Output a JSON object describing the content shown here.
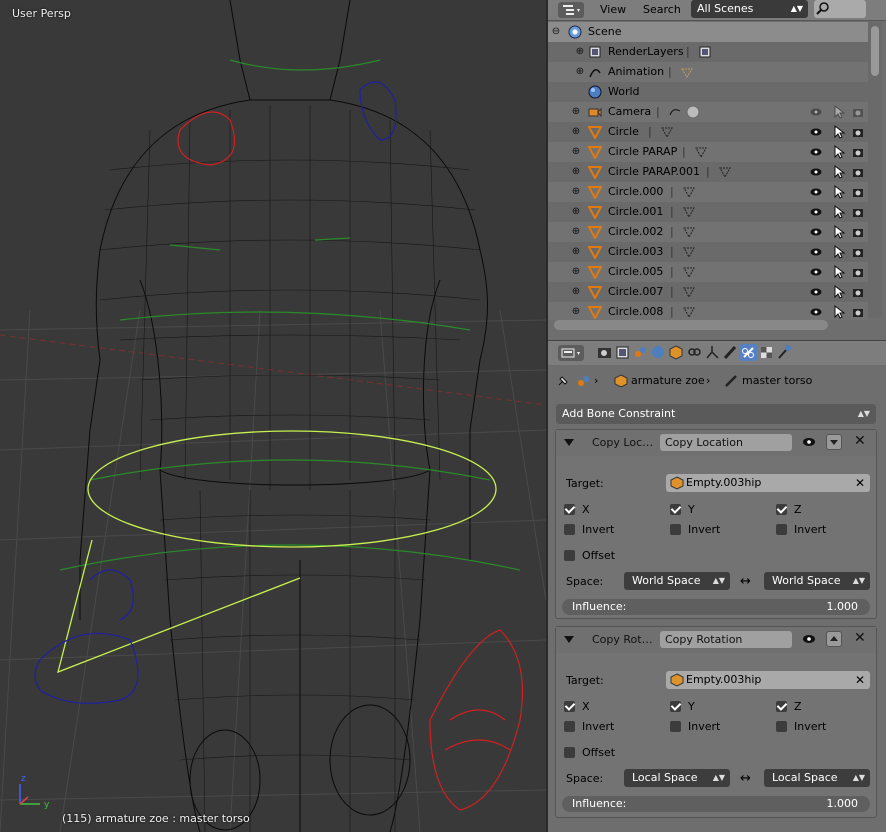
{
  "viewport": {
    "view_label": "User Persp",
    "status": "(115) armature zoe : master torso"
  },
  "outliner": {
    "header": {
      "menu_view": "View",
      "menu_search": "Search",
      "scenes_dropdown": "All Scenes"
    },
    "rows": [
      {
        "name": "Scene",
        "icon": "scene-icon"
      },
      {
        "name": "RenderLayers",
        "icon": "renderlayers-icon"
      },
      {
        "name": "Animation",
        "icon": "animation-icon"
      },
      {
        "name": "World",
        "icon": "world-icon"
      },
      {
        "name": "Camera",
        "icon": "camera-icon"
      },
      {
        "name": "Circle",
        "icon": "mesh-icon"
      },
      {
        "name": "Circle PARAP",
        "icon": "mesh-icon"
      },
      {
        "name": "Circle PARAP.001",
        "icon": "mesh-icon"
      },
      {
        "name": "Circle.000",
        "icon": "mesh-icon"
      },
      {
        "name": "Circle.001",
        "icon": "mesh-icon"
      },
      {
        "name": "Circle.002",
        "icon": "mesh-icon"
      },
      {
        "name": "Circle.003",
        "icon": "mesh-icon"
      },
      {
        "name": "Circle.005",
        "icon": "mesh-icon"
      },
      {
        "name": "Circle.007",
        "icon": "mesh-icon"
      },
      {
        "name": "Circle.008",
        "icon": "mesh-icon"
      }
    ]
  },
  "properties": {
    "breadcrumb": {
      "object": "armature zoe",
      "bone": "master torso"
    },
    "add_constraint_label": "Add Bone Constraint",
    "constraints": [
      {
        "title": "Copy Loc…",
        "name": "Copy Location",
        "target_label": "Target:",
        "target": "Empty.003hip",
        "x_label": "X",
        "y_label": "Y",
        "z_label": "Z",
        "invert_label": "Invert",
        "offset_label": "Offset",
        "space_label": "Space:",
        "owner_space": "World Space",
        "target_space": "World Space",
        "influence_label": "Influence:",
        "influence": "1.000"
      },
      {
        "title": "Copy Rot…",
        "name": "Copy Rotation",
        "target_label": "Target:",
        "target": "Empty.003hip",
        "x_label": "X",
        "y_label": "Y",
        "z_label": "Z",
        "invert_label": "Invert",
        "offset_label": "Offset",
        "space_label": "Space:",
        "owner_space": "Local Space",
        "target_space": "Local Space",
        "influence_label": "Influence:",
        "influence": "1.000"
      }
    ]
  },
  "colors": {
    "viewport_bg": "#393939",
    "selection_yellow": "#c8f050",
    "bone_green": "#2a8a2a",
    "ik_red": "#d02020",
    "ik_blue": "#2020a0",
    "active_tab": "#5680c2"
  }
}
